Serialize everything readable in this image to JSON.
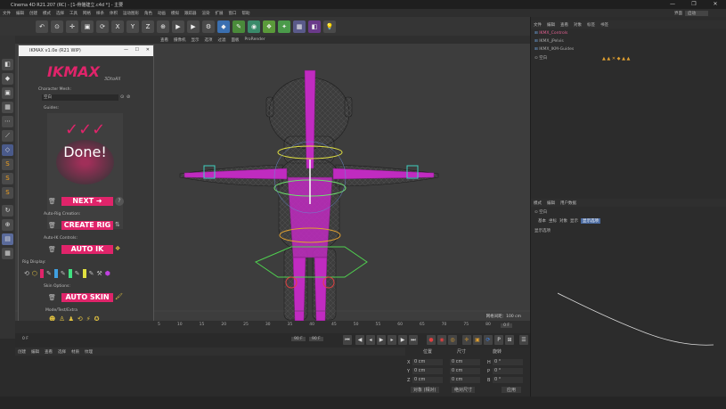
{
  "window": {
    "title": "Cinema 4D R21.207 (RC) - [1-骨骼建立.c4d *] - 主要",
    "minimize": "—",
    "maximize": "❐",
    "close": "✕"
  },
  "menubar": [
    "文件",
    "编辑",
    "创建",
    "模式",
    "选择",
    "工具",
    "网格",
    "样条",
    "体积",
    "运动图形",
    "角色",
    "动画",
    "模拟",
    "跟踪器",
    "渲染",
    "扩展",
    "窗口",
    "帮助"
  ],
  "layout_label": "界面",
  "layout_value": "启动",
  "vp_menu": [
    "查看",
    "摄像机",
    "显示",
    "选项",
    "过滤",
    "面板",
    "ProRender"
  ],
  "viewport": {
    "grid_label": "网格间距：100 cm"
  },
  "plugin": {
    "title": "IKMAX v1.0e (R21 WIP)",
    "logo_main": "IKMAX",
    "logo_sub": "3DtoAll",
    "character_mesh_label": "Character Mesh:",
    "mesh_value": "空白",
    "guides_label": "Guides:",
    "done_text": "Done!",
    "next_label": "NEXT ➜",
    "help_label": "?",
    "auto_rig_label": "Auto-Rig Creation:",
    "create_rig_label": "CREATE RIG",
    "auto_ik_controls_label": "Auto-IK Controls:",
    "auto_ik_label": "AUTO IK",
    "rig_display_label": "Rig Display:",
    "skin_options_label": "Skin Options:",
    "auto_skin_label": "AUTO SKIN",
    "mode_label": "Mode/Test/Extra",
    "copyright": "(c) 2018 3DtoAll. All Rights Reserved"
  },
  "timeline": {
    "ticks": [
      "5",
      "10",
      "15",
      "20",
      "25",
      "30",
      "35",
      "40",
      "45",
      "50",
      "55",
      "60",
      "65",
      "70",
      "75",
      "80",
      "85",
      "90"
    ],
    "current": "0 F",
    "start": "0 F",
    "end": "90 F",
    "end2": "90 F"
  },
  "matbar": [
    "创建",
    "编辑",
    "查看",
    "选择",
    "材质",
    "纹理"
  ],
  "coords": {
    "headers": [
      "位置",
      "尺寸",
      "旋转"
    ],
    "rows": [
      {
        "axis": "X",
        "pos": "0 cm",
        "size": "0 cm",
        "rot_label": "H",
        "rot": "0 °"
      },
      {
        "axis": "Y",
        "pos": "0 cm",
        "size": "0 cm",
        "rot_label": "P",
        "rot": "0 °"
      },
      {
        "axis": "Z",
        "pos": "0 cm",
        "size": "0 cm",
        "rot_label": "B",
        "rot": "0 °"
      }
    ],
    "mode": "对象 (相对)",
    "size_mode": "绝对尺寸",
    "apply": "应用"
  },
  "right": {
    "top_menu": [
      "文件",
      "编辑",
      "查看",
      "对象",
      "标签",
      "书签"
    ],
    "objects": [
      "IKMX_Controls",
      "IKMX_jPelvis",
      "IKMX_IKM-Guides",
      "空白"
    ],
    "attr_menu": [
      "模式",
      "编辑",
      "用户数据"
    ],
    "attr_title": "空白",
    "attr_tabs": [
      "基本",
      "坐标",
      "对象",
      "显示",
      "显示选项"
    ],
    "attr_section": "显示选项",
    "graph_x": [
      "0",
      "0.2",
      "0.4",
      "0.6",
      "0.8",
      "1.0"
    ],
    "graph_y": [
      "1",
      "0.8",
      "0.6",
      "0.4",
      "0.2"
    ],
    "layout_top": "启动",
    "layout_label_right": "界面"
  },
  "accent_color": "#e0246a",
  "rig_color": "#c02bc0"
}
